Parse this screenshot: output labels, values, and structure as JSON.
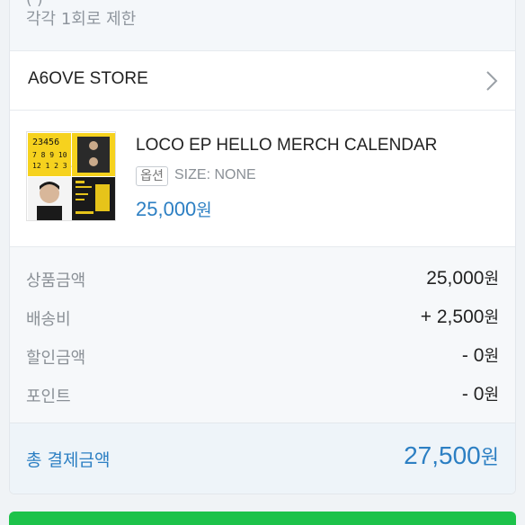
{
  "notice": {
    "cut_text": "(               )",
    "limit_text": "각각 1회로 제한"
  },
  "store": {
    "name": "A6OVE STORE",
    "chevron_icon": "chevron-right-icon"
  },
  "product": {
    "thumbnail_text": [
      "23456",
      "7 8 9 10 11",
      "12 1 2 3 4"
    ],
    "title": "LOCO EP HELLO MERCH CALENDAR",
    "option_badge": "옵션",
    "option_value": "SIZE: NONE",
    "price": "25,000",
    "price_unit": "원"
  },
  "summary": {
    "rows": [
      {
        "label": "상품금액",
        "value": "25,000",
        "unit": "원"
      },
      {
        "label": "배송비",
        "value": "+ 2,500",
        "unit": "원"
      },
      {
        "label": "할인금액",
        "value": "- 0",
        "unit": "원"
      },
      {
        "label": "포인트",
        "value": "- 0",
        "unit": "원"
      }
    ]
  },
  "total": {
    "label": "총 결제금액",
    "value": "27,500",
    "unit": "원"
  },
  "colors": {
    "accent": "#2c7fc3",
    "pay_button": "#1dc24a"
  }
}
